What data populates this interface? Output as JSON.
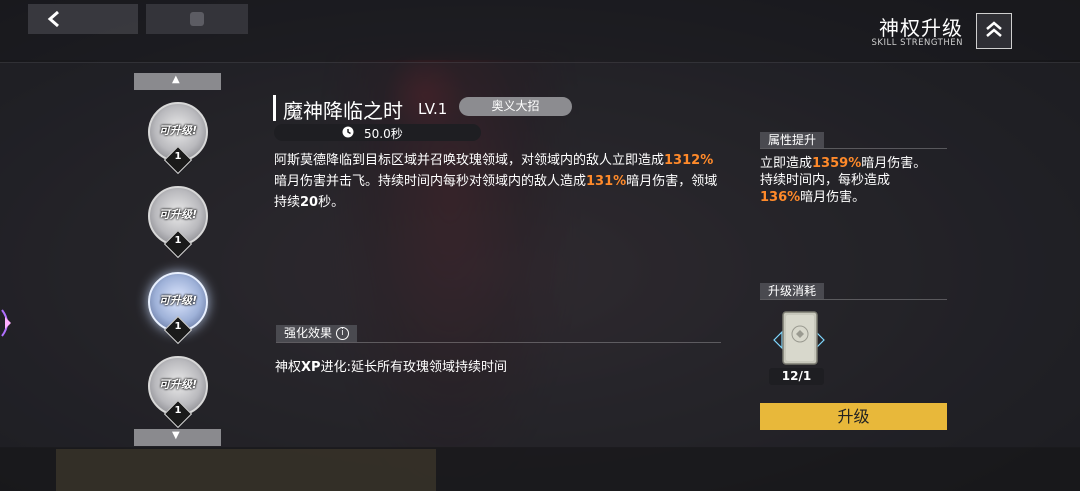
{
  "header": {
    "title": "神权升级",
    "subtitle": "SKILL STRENGTHEN"
  },
  "skill_list": {
    "nodes": [
      {
        "status": "可升级!",
        "level": "1",
        "active": false
      },
      {
        "status": "可升级!",
        "level": "1",
        "active": false
      },
      {
        "status": "可升级!",
        "level": "1",
        "active": true
      },
      {
        "status": "可升级!",
        "level": "1",
        "active": false
      }
    ]
  },
  "skill": {
    "name": "魔神降临之时",
    "level": "LV.1",
    "tag": "奥义大招",
    "cooldown": "50.0秒",
    "description": {
      "p1": "阿斯莫德降临到目标区域并召唤玫瑰领域，对领域内的敌人立即造成",
      "v1": "1312%",
      "p2": "暗月伤害并击飞。持续时间内每秒对领域内的敌人造成",
      "v2": "131%",
      "p3": "暗月伤害，领域持续",
      "v3": "20",
      "p4": "秒。"
    }
  },
  "effect": {
    "header": "强化效果",
    "text_a": "神权",
    "text_b": "XP",
    "text_c": "进化:延长所有玫瑰领域持续时间"
  },
  "attribute": {
    "header": "属性提升",
    "p1": "立即造成",
    "v1": "1359%",
    "p2": "暗月伤害。",
    "p3": "持续时间内，每秒造成",
    "v2": "136%",
    "p4": "暗月伤害。"
  },
  "cost": {
    "header": "升级消耗",
    "count": "12/1"
  },
  "upgrade_button": "升级",
  "colors": {
    "highlight": "#ff8a2a",
    "button": "#e8b83a"
  }
}
